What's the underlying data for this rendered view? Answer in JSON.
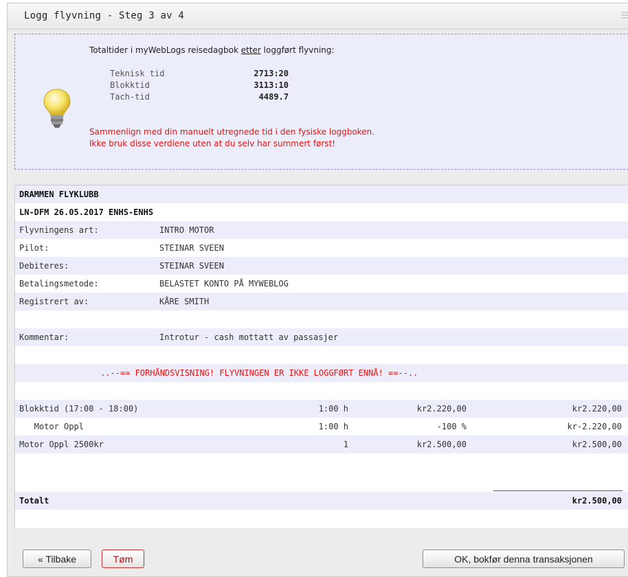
{
  "window": {
    "title": "Logg flyvning - Steg 3 av 4"
  },
  "info": {
    "heading_before": "Totaltider i myWebLogs reisedagbok ",
    "heading_underlined": "etter",
    "heading_after": " loggført flyvning:",
    "bulb_icon": "lightbulb-icon",
    "times": [
      {
        "label": "Teknisk tid",
        "value": "2713:20"
      },
      {
        "label": "Blokktid",
        "value": "3113:10"
      },
      {
        "label": "Tach-tid",
        "value": "4489.7"
      }
    ],
    "warning_line1": "Sammenlign med din manuelt utregnede tid i den fysiske loggboken.",
    "warning_line2": "Ikke bruk disse verdiene uten at du selv har summert først!"
  },
  "receipt": {
    "club": "DRAMMEN FLYKLUBB",
    "flight_line": "LN-DFM 26.05.2017 ENHS-ENHS",
    "fields": [
      {
        "label": "Flyvningens art:",
        "value": "INTRO MOTOR"
      },
      {
        "label": "Pilot:",
        "value": "STEINAR SVEEN"
      },
      {
        "label": "Debiteres:",
        "value": "STEINAR SVEEN"
      },
      {
        "label": "Betalingsmetode:",
        "value": "BELASTET KONTO PÅ MYWEBLOG"
      },
      {
        "label": "Registrert av:",
        "value": "KÅRE SMITH"
      }
    ],
    "comment_label": "Kommentar:",
    "comment_value": "Introtur - cash mottatt av passasjer",
    "preview_notice": "..--== FORHÅNDSVISNING! FLYVNINGEN ER IKKE LOGGFØRT ENNÅ! ==--..",
    "lines": [
      {
        "desc": "Blokktid (17:00 - 18:00)",
        "qty": "1:00 h",
        "price": "kr2.220,00",
        "amount": "kr2.220,00"
      },
      {
        "desc": "   Motor Oppl",
        "qty": "1:00 h",
        "price": "-100 %",
        "amount": "kr-2.220,00"
      },
      {
        "desc": "Motor Oppl 2500kr",
        "qty": "1",
        "price": "kr2.500,00",
        "amount": "kr2.500,00"
      }
    ],
    "total_label": "Totalt",
    "total_value": "kr2.500,00"
  },
  "buttons": {
    "back": "« Tilbake",
    "clear": "Tøm",
    "confirm": "OK, bokfør denna transaksjonen"
  },
  "colors": {
    "warning": "#e8120f",
    "info_bg": "#ecedfb",
    "row_shade": "#ececfa"
  }
}
